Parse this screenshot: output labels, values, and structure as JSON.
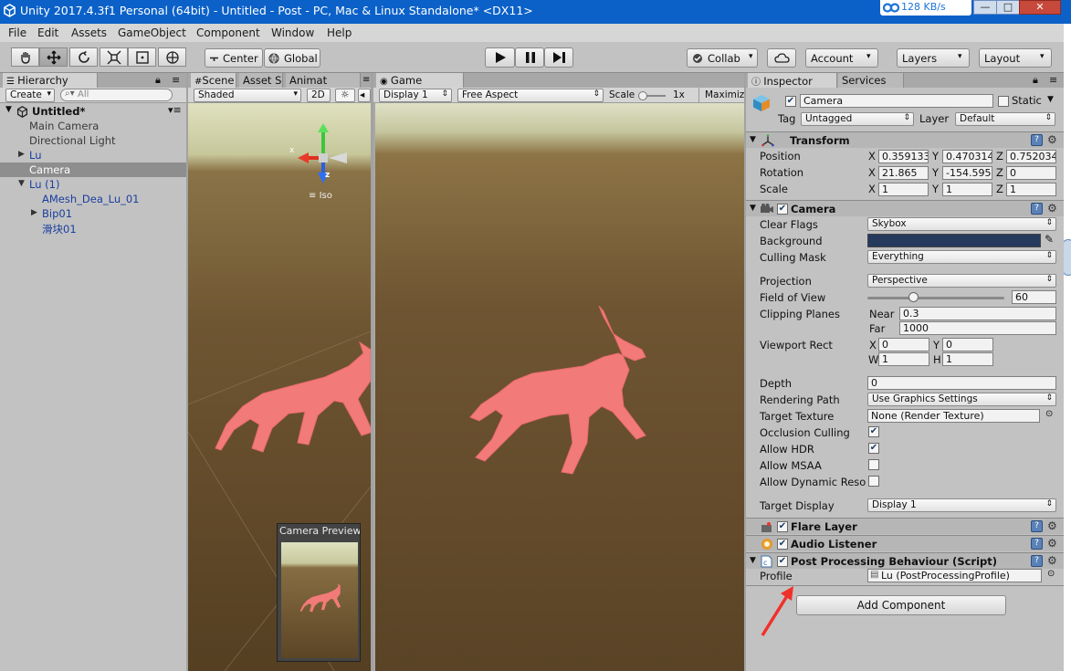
{
  "window": {
    "title": "Unity 2017.4.3f1 Personal (64bit) - Untitled - Post - PC, Mac & Linux Standalone* <DX11>",
    "net_speed": "128 KB/s",
    "min_glyph": "—",
    "max_glyph": "□",
    "close_glyph": "✕"
  },
  "menu": [
    "File",
    "Edit",
    "Assets",
    "GameObject",
    "Component",
    "Window",
    "Help"
  ],
  "toolbar": {
    "pivot": "Center",
    "space": "Global",
    "collab": "Collab",
    "account": "Account",
    "layers": "Layers",
    "layout": "Layout"
  },
  "hierarchy": {
    "tab": "Hierarchy",
    "create": "Create",
    "search_placeholder": "All",
    "scene_name": "Untitled*",
    "items": [
      "Main Camera",
      "Directional Light",
      "Lu",
      "Camera",
      "Lu (1)",
      "AMesh_Dea_Lu_01",
      "Bip01",
      "滑块01"
    ]
  },
  "scene": {
    "tabs": [
      "Scene",
      "Asset S",
      "Animat"
    ],
    "shading": "Shaded",
    "mode_2d": "2D",
    "iso": "Iso",
    "gizmo_x": "x",
    "gizmo_z": "z",
    "camera_preview": "Camera Preview"
  },
  "game": {
    "tab": "Game",
    "display": "Display 1",
    "aspect": "Free Aspect",
    "scale_label": "Scale",
    "scale_value": "1x",
    "maximize": "Maximiz"
  },
  "inspector": {
    "tabs": [
      "Inspector",
      "Services"
    ],
    "object_name": "Camera",
    "static_label": "Static",
    "tag_label": "Tag",
    "tag_value": "Untagged",
    "layer_label": "Layer",
    "layer_value": "Default",
    "transform": {
      "title": "Transform",
      "position_label": "Position",
      "rotation_label": "Rotation",
      "scale_label": "Scale",
      "axis_x": "X",
      "axis_y": "Y",
      "axis_z": "Z",
      "position": [
        "0.359133",
        "0.470314",
        "0.752034"
      ],
      "rotation": [
        "21.865",
        "-154.595",
        "0"
      ],
      "scale": [
        "1",
        "1",
        "1"
      ]
    },
    "camera": {
      "title": "Camera",
      "clear_flags_label": "Clear Flags",
      "clear_flags": "Skybox",
      "background_label": "Background",
      "background_color": "#263a5e",
      "culling_mask_label": "Culling Mask",
      "culling_mask": "Everything",
      "projection_label": "Projection",
      "projection": "Perspective",
      "fov_label": "Field of View",
      "fov": "60",
      "fov_fraction": 0.33,
      "clipping_label": "Clipping Planes",
      "near_label": "Near",
      "near": "0.3",
      "far_label": "Far",
      "far": "1000",
      "viewport_label": "Viewport Rect",
      "vp_x_label": "X",
      "vp_x": "0",
      "vp_y_label": "Y",
      "vp_y": "0",
      "vp_w_label": "W",
      "vp_w": "1",
      "vp_h_label": "H",
      "vp_h": "1",
      "depth_label": "Depth",
      "depth": "0",
      "rendering_path_label": "Rendering Path",
      "rendering_path": "Use Graphics Settings",
      "target_texture_label": "Target Texture",
      "target_texture": "None (Render Texture)",
      "occlusion_label": "Occlusion Culling",
      "occlusion": true,
      "hdr_label": "Allow HDR",
      "hdr": true,
      "msaa_label": "Allow MSAA",
      "msaa": false,
      "dynres_label": "Allow Dynamic Reso",
      "dynres": false,
      "target_display_label": "Target Display",
      "target_display": "Display 1"
    },
    "flare_layer": "Flare Layer",
    "audio_listener": "Audio Listener",
    "post_processing": {
      "title": "Post Processing Behaviour (Script)",
      "profile_label": "Profile",
      "profile_value": "Lu (PostProcessingProfile)"
    },
    "add_component": "Add Component"
  },
  "colors": {
    "title_bar": "#0b61c8",
    "annotation_arrow": "#f0302a",
    "deer": "#f27a78"
  }
}
